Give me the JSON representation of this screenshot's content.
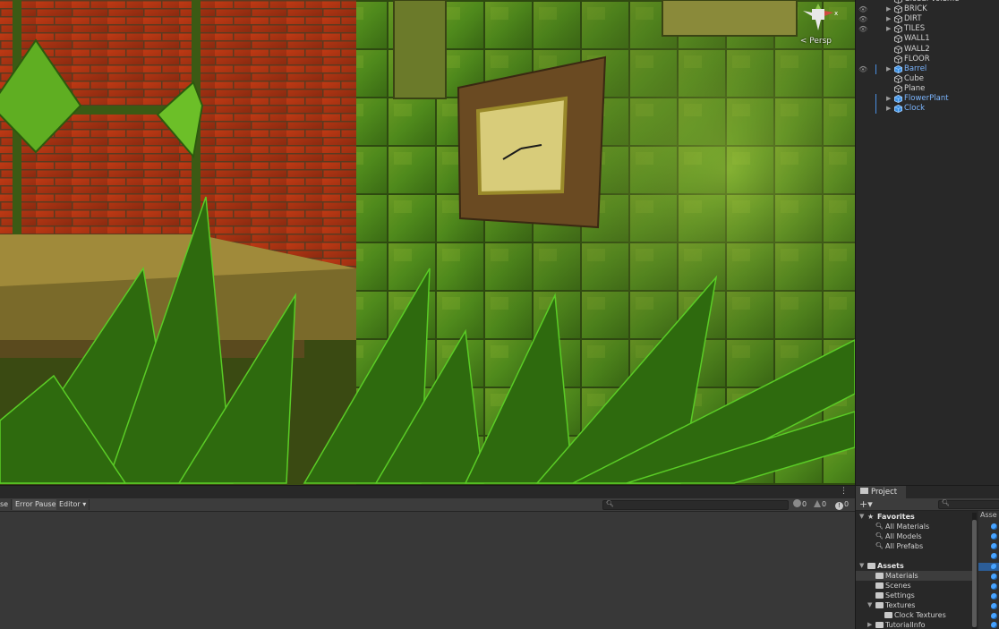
{
  "scene": {
    "camera_mode_label": "< Persp"
  },
  "hierarchy": {
    "items": [
      {
        "label": "Global Volume",
        "expandable": false,
        "prefab": false,
        "eye": false,
        "bar": false
      },
      {
        "label": "BRICK",
        "expandable": true,
        "prefab": false,
        "eye": true,
        "bar": false
      },
      {
        "label": "DIRT",
        "expandable": true,
        "prefab": false,
        "eye": true,
        "bar": false
      },
      {
        "label": "TILES",
        "expandable": true,
        "prefab": false,
        "eye": true,
        "bar": false
      },
      {
        "label": "WALL1",
        "expandable": false,
        "prefab": false,
        "eye": false,
        "bar": false
      },
      {
        "label": "WALL2",
        "expandable": false,
        "prefab": false,
        "eye": false,
        "bar": false
      },
      {
        "label": "FLOOR",
        "expandable": false,
        "prefab": false,
        "eye": false,
        "bar": false
      },
      {
        "label": "Barrel",
        "expandable": true,
        "prefab": true,
        "eye": true,
        "bar": true
      },
      {
        "label": "Cube",
        "expandable": false,
        "prefab": false,
        "eye": false,
        "bar": false
      },
      {
        "label": "Plane",
        "expandable": false,
        "prefab": false,
        "eye": false,
        "bar": false
      },
      {
        "label": "FlowerPlant",
        "expandable": true,
        "prefab": true,
        "eye": false,
        "bar": true
      },
      {
        "label": "Clock",
        "expandable": true,
        "prefab": true,
        "eye": false,
        "bar": true
      }
    ]
  },
  "console": {
    "buttons": {
      "clear_on_play_partial": "se",
      "error_pause": "Error Pause",
      "editor": "Editor ▾"
    },
    "counts": {
      "log": "0",
      "warning": "0",
      "error": "0"
    }
  },
  "project": {
    "tab_label": "Project",
    "assets_column_header": "Asse",
    "favorites": {
      "label": "Favorites",
      "items": [
        "All Materials",
        "All Models",
        "All Prefabs"
      ]
    },
    "assets": {
      "label": "Assets",
      "folders": [
        "Materials",
        "Scenes",
        "Settings",
        "Textures"
      ],
      "subfolder": "Clock Textures",
      "last": "TutorialInfo"
    }
  },
  "colors": {
    "prefab_blue": "#7cb6ff",
    "panel_dark": "#282828",
    "console_bg": "#383838",
    "selection": "#2c5d97"
  }
}
